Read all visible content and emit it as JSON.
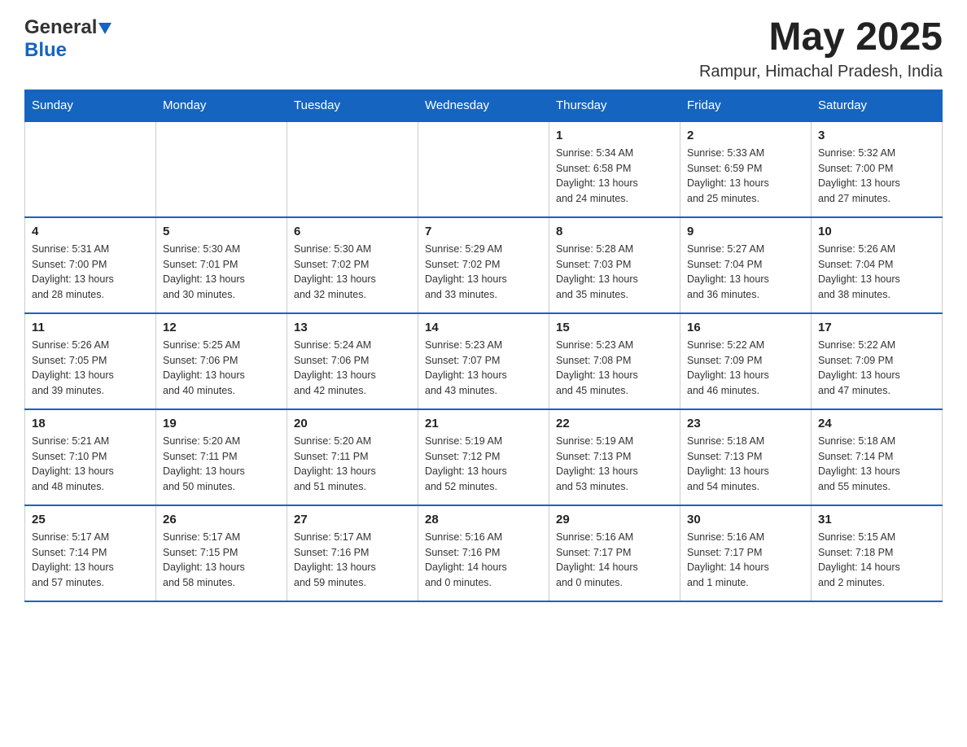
{
  "logo": {
    "text_general": "General",
    "text_blue": "Blue"
  },
  "header": {
    "month": "May 2025",
    "location": "Rampur, Himachal Pradesh, India"
  },
  "weekdays": [
    "Sunday",
    "Monday",
    "Tuesday",
    "Wednesday",
    "Thursday",
    "Friday",
    "Saturday"
  ],
  "weeks": [
    [
      {
        "day": "",
        "info": ""
      },
      {
        "day": "",
        "info": ""
      },
      {
        "day": "",
        "info": ""
      },
      {
        "day": "",
        "info": ""
      },
      {
        "day": "1",
        "info": "Sunrise: 5:34 AM\nSunset: 6:58 PM\nDaylight: 13 hours\nand 24 minutes."
      },
      {
        "day": "2",
        "info": "Sunrise: 5:33 AM\nSunset: 6:59 PM\nDaylight: 13 hours\nand 25 minutes."
      },
      {
        "day": "3",
        "info": "Sunrise: 5:32 AM\nSunset: 7:00 PM\nDaylight: 13 hours\nand 27 minutes."
      }
    ],
    [
      {
        "day": "4",
        "info": "Sunrise: 5:31 AM\nSunset: 7:00 PM\nDaylight: 13 hours\nand 28 minutes."
      },
      {
        "day": "5",
        "info": "Sunrise: 5:30 AM\nSunset: 7:01 PM\nDaylight: 13 hours\nand 30 minutes."
      },
      {
        "day": "6",
        "info": "Sunrise: 5:30 AM\nSunset: 7:02 PM\nDaylight: 13 hours\nand 32 minutes."
      },
      {
        "day": "7",
        "info": "Sunrise: 5:29 AM\nSunset: 7:02 PM\nDaylight: 13 hours\nand 33 minutes."
      },
      {
        "day": "8",
        "info": "Sunrise: 5:28 AM\nSunset: 7:03 PM\nDaylight: 13 hours\nand 35 minutes."
      },
      {
        "day": "9",
        "info": "Sunrise: 5:27 AM\nSunset: 7:04 PM\nDaylight: 13 hours\nand 36 minutes."
      },
      {
        "day": "10",
        "info": "Sunrise: 5:26 AM\nSunset: 7:04 PM\nDaylight: 13 hours\nand 38 minutes."
      }
    ],
    [
      {
        "day": "11",
        "info": "Sunrise: 5:26 AM\nSunset: 7:05 PM\nDaylight: 13 hours\nand 39 minutes."
      },
      {
        "day": "12",
        "info": "Sunrise: 5:25 AM\nSunset: 7:06 PM\nDaylight: 13 hours\nand 40 minutes."
      },
      {
        "day": "13",
        "info": "Sunrise: 5:24 AM\nSunset: 7:06 PM\nDaylight: 13 hours\nand 42 minutes."
      },
      {
        "day": "14",
        "info": "Sunrise: 5:23 AM\nSunset: 7:07 PM\nDaylight: 13 hours\nand 43 minutes."
      },
      {
        "day": "15",
        "info": "Sunrise: 5:23 AM\nSunset: 7:08 PM\nDaylight: 13 hours\nand 45 minutes."
      },
      {
        "day": "16",
        "info": "Sunrise: 5:22 AM\nSunset: 7:09 PM\nDaylight: 13 hours\nand 46 minutes."
      },
      {
        "day": "17",
        "info": "Sunrise: 5:22 AM\nSunset: 7:09 PM\nDaylight: 13 hours\nand 47 minutes."
      }
    ],
    [
      {
        "day": "18",
        "info": "Sunrise: 5:21 AM\nSunset: 7:10 PM\nDaylight: 13 hours\nand 48 minutes."
      },
      {
        "day": "19",
        "info": "Sunrise: 5:20 AM\nSunset: 7:11 PM\nDaylight: 13 hours\nand 50 minutes."
      },
      {
        "day": "20",
        "info": "Sunrise: 5:20 AM\nSunset: 7:11 PM\nDaylight: 13 hours\nand 51 minutes."
      },
      {
        "day": "21",
        "info": "Sunrise: 5:19 AM\nSunset: 7:12 PM\nDaylight: 13 hours\nand 52 minutes."
      },
      {
        "day": "22",
        "info": "Sunrise: 5:19 AM\nSunset: 7:13 PM\nDaylight: 13 hours\nand 53 minutes."
      },
      {
        "day": "23",
        "info": "Sunrise: 5:18 AM\nSunset: 7:13 PM\nDaylight: 13 hours\nand 54 minutes."
      },
      {
        "day": "24",
        "info": "Sunrise: 5:18 AM\nSunset: 7:14 PM\nDaylight: 13 hours\nand 55 minutes."
      }
    ],
    [
      {
        "day": "25",
        "info": "Sunrise: 5:17 AM\nSunset: 7:14 PM\nDaylight: 13 hours\nand 57 minutes."
      },
      {
        "day": "26",
        "info": "Sunrise: 5:17 AM\nSunset: 7:15 PM\nDaylight: 13 hours\nand 58 minutes."
      },
      {
        "day": "27",
        "info": "Sunrise: 5:17 AM\nSunset: 7:16 PM\nDaylight: 13 hours\nand 59 minutes."
      },
      {
        "day": "28",
        "info": "Sunrise: 5:16 AM\nSunset: 7:16 PM\nDaylight: 14 hours\nand 0 minutes."
      },
      {
        "day": "29",
        "info": "Sunrise: 5:16 AM\nSunset: 7:17 PM\nDaylight: 14 hours\nand 0 minutes."
      },
      {
        "day": "30",
        "info": "Sunrise: 5:16 AM\nSunset: 7:17 PM\nDaylight: 14 hours\nand 1 minute."
      },
      {
        "day": "31",
        "info": "Sunrise: 5:15 AM\nSunset: 7:18 PM\nDaylight: 14 hours\nand 2 minutes."
      }
    ]
  ]
}
